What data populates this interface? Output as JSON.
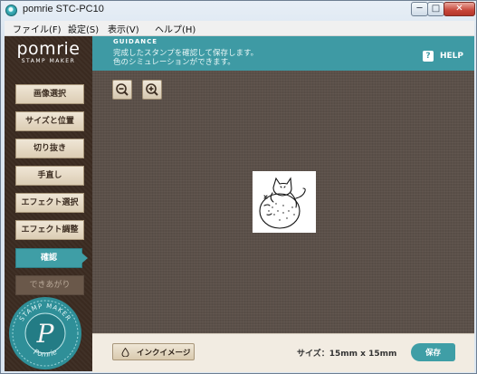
{
  "window": {
    "title": "pomrie STC-PC10",
    "buttons": {
      "minimize": "─",
      "maximize": "□",
      "close": "✕"
    }
  },
  "menu": [
    "ファイル(F)",
    "設定(S)",
    "表示(V)",
    "ヘルプ(H)"
  ],
  "logo": {
    "main": "pomrie",
    "sub": "STAMP MAKER"
  },
  "sidebar": {
    "items": [
      {
        "label": "画像選択",
        "state": "normal"
      },
      {
        "label": "サイズと位置",
        "state": "normal"
      },
      {
        "label": "切り抜き",
        "state": "normal"
      },
      {
        "label": "手直し",
        "state": "normal"
      },
      {
        "label": "エフェクト選択",
        "state": "normal"
      },
      {
        "label": "エフェクト調整",
        "state": "normal"
      },
      {
        "label": "確認",
        "state": "active"
      },
      {
        "label": "できあがり",
        "state": "disabled"
      }
    ],
    "seal_text": {
      "top": "STAMP MAKER",
      "letter": "P",
      "bottom": "Pomrie"
    }
  },
  "guidance": {
    "tag": "GUIDANCE",
    "line1": "完成したスタンプを確認して保存します。",
    "line2": "色のシミュレーションができます。",
    "help_label": "HELP",
    "help_icon": "?"
  },
  "toolbar": {
    "zoom_out_icon": "zoom-out-icon",
    "zoom_in_icon": "zoom-in-icon"
  },
  "bottom": {
    "ink_button_label": "インクイメージ",
    "size_text": "サイズ：15mm x 15mm",
    "save_label": "保存"
  },
  "colors": {
    "accent": "#3e9aa4",
    "sidebar_bg": "#3a2a20",
    "canvas_bg": "#5b5049",
    "button_bg": "#dccdb4"
  }
}
